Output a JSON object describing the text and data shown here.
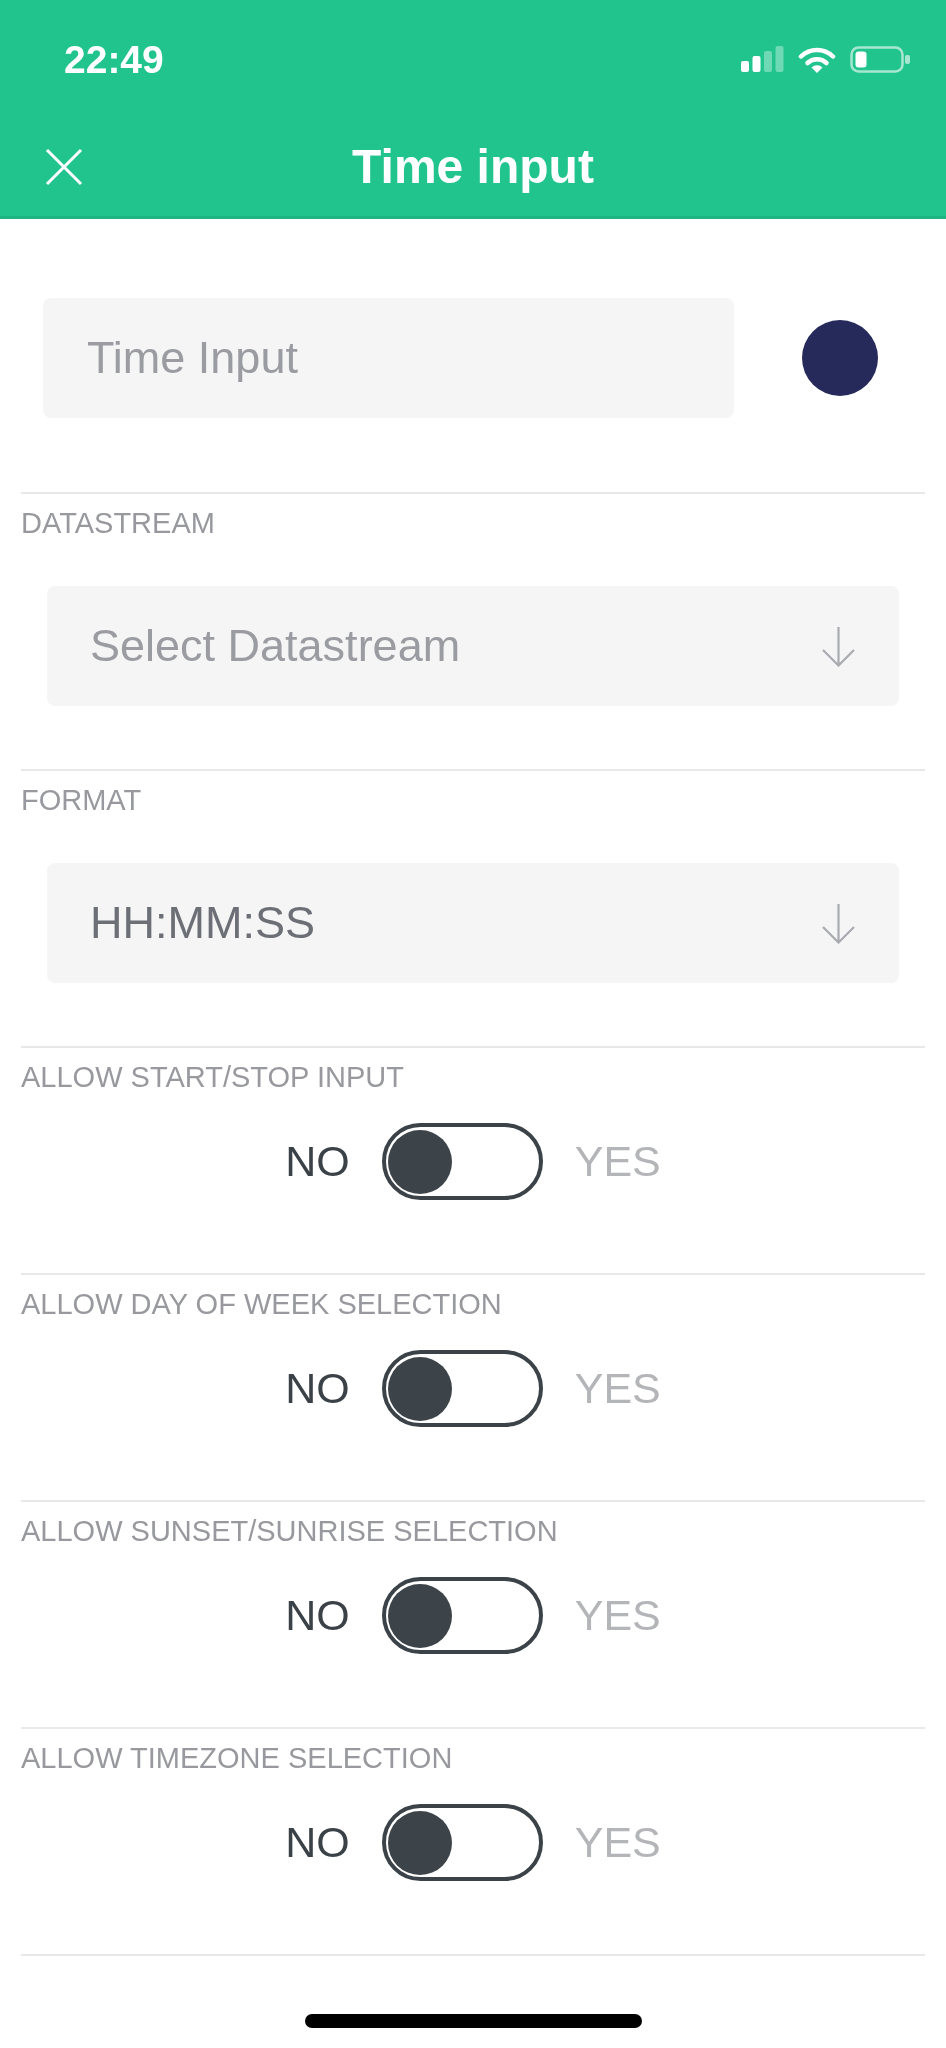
{
  "status_bar": {
    "time": "22:49"
  },
  "header": {
    "title": "Time input"
  },
  "name_field": {
    "placeholder": "Time Input",
    "color": "#262a5a"
  },
  "sections": [
    {
      "kind": "select",
      "label": "DATASTREAM",
      "placeholder": "Select Datastream"
    },
    {
      "kind": "select",
      "label": "FORMAT",
      "value": "HH:MM:SS"
    },
    {
      "kind": "toggle",
      "label": "ALLOW START/STOP INPUT",
      "off_label": "NO",
      "on_label": "YES",
      "on": false
    },
    {
      "kind": "toggle",
      "label": "ALLOW DAY OF WEEK SELECTION",
      "off_label": "NO",
      "on_label": "YES",
      "on": false
    },
    {
      "kind": "toggle",
      "label": "ALLOW SUNSET/SUNRISE SELECTION",
      "off_label": "NO",
      "on_label": "YES",
      "on": false
    },
    {
      "kind": "toggle",
      "label": "ALLOW TIMEZONE SELECTION",
      "off_label": "NO",
      "on_label": "YES",
      "on": false
    }
  ]
}
